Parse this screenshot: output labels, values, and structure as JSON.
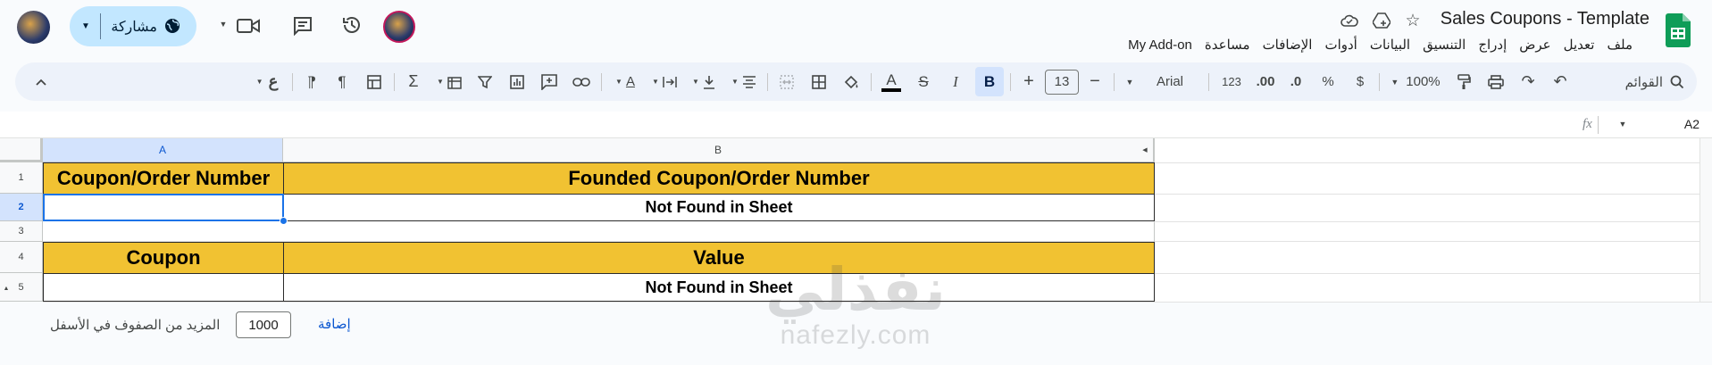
{
  "header": {
    "title": "Sales Coupons - Template",
    "menu": [
      "ملف",
      "تعديل",
      "عرض",
      "إدراج",
      "التنسيق",
      "البيانات",
      "أدوات",
      "الإضافات",
      "مساعدة",
      "My Add-on"
    ],
    "share_label": "مشاركة"
  },
  "toolbar": {
    "search_placeholder": "القوائم",
    "zoom": "100%",
    "currency": "$",
    "percent": "%",
    "dec_decrease": ".0",
    "dec_increase": ".00",
    "number_format": "123",
    "font": "Arial",
    "font_size": "13",
    "bold": "B",
    "italic": "I",
    "text_color_letter": "A",
    "rtl_glyph": "ع",
    "text_color_hex": "#000000"
  },
  "formula_bar": {
    "name_box": "A2",
    "fx": "fx",
    "formula": ""
  },
  "grid": {
    "columns": [
      "A",
      "B"
    ],
    "rows": [
      "1",
      "2",
      "3",
      "4",
      "5"
    ],
    "cells": {
      "a1": "Coupon/Order Number",
      "b1": "Founded Coupon/Order Number",
      "a2": "",
      "b2": "Not Found in Sheet",
      "a4": "Coupon",
      "b4": "Value",
      "a5": "",
      "b5": "Not Found in Sheet"
    },
    "header_fill": "#f1c232",
    "selected_cell": "A2"
  },
  "footer": {
    "rows_count": "1000",
    "rows_text": "المزيد من الصفوف في الأسفل",
    "add_label": "إضافة"
  },
  "watermark": {
    "arabic": "نفذلي",
    "latin": "nafezly.com"
  },
  "colors": {
    "accent": "#0b57d0",
    "share_bg": "#c2e7ff",
    "sheets_green": "#0f9d58"
  }
}
